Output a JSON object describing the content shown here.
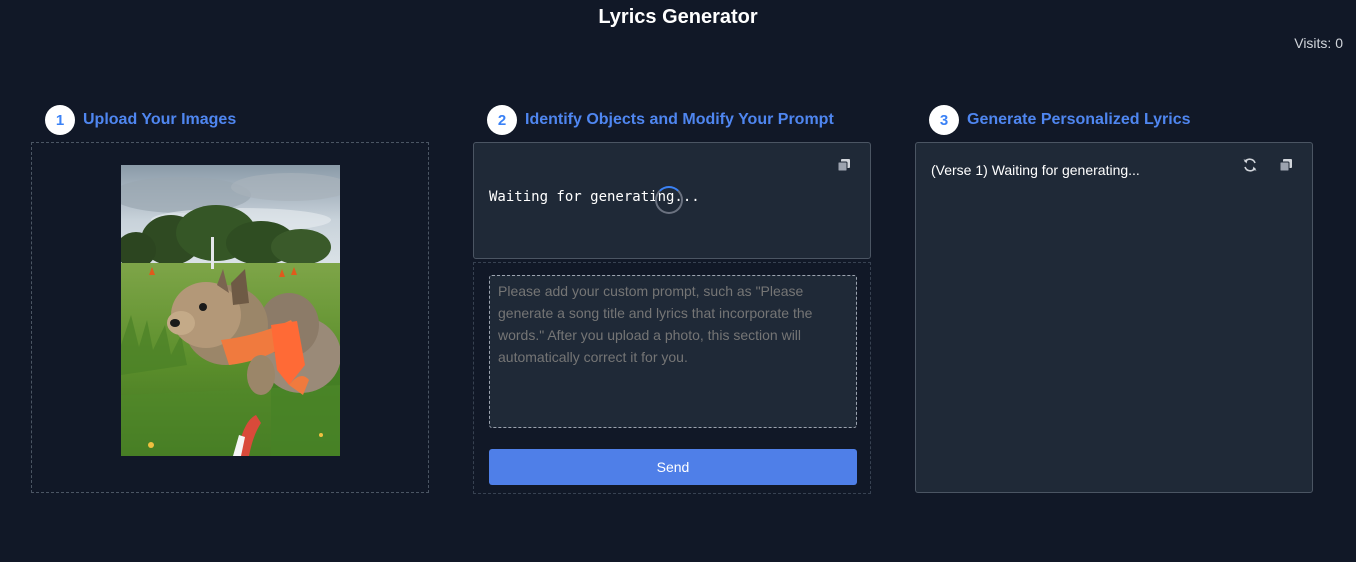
{
  "app": {
    "title": "Lyrics Generator",
    "visits": "Visits: 0"
  },
  "steps": [
    {
      "number": "1",
      "label": "Upload Your Images"
    },
    {
      "number": "2",
      "label": "Identify Objects and Modify Your Prompt"
    },
    {
      "number": "3",
      "label": "Generate Personalized Lyrics"
    }
  ],
  "upload": {
    "image_description": "photo-of-small-dog-on-grass"
  },
  "identify": {
    "result_text": "Waiting for generating...",
    "prompt_placeholder": "Please add your custom prompt, such as \"Please generate a song title and lyrics that incorporate the words.\" After you upload a photo, this section will automatically correct it for you.",
    "send_label": "Send"
  },
  "lyrics": {
    "text": "(Verse 1) Waiting for generating..."
  },
  "colors": {
    "background": "#111827",
    "panel": "#1f2937",
    "accent": "#4f86f0",
    "button": "#4f7fe8"
  }
}
